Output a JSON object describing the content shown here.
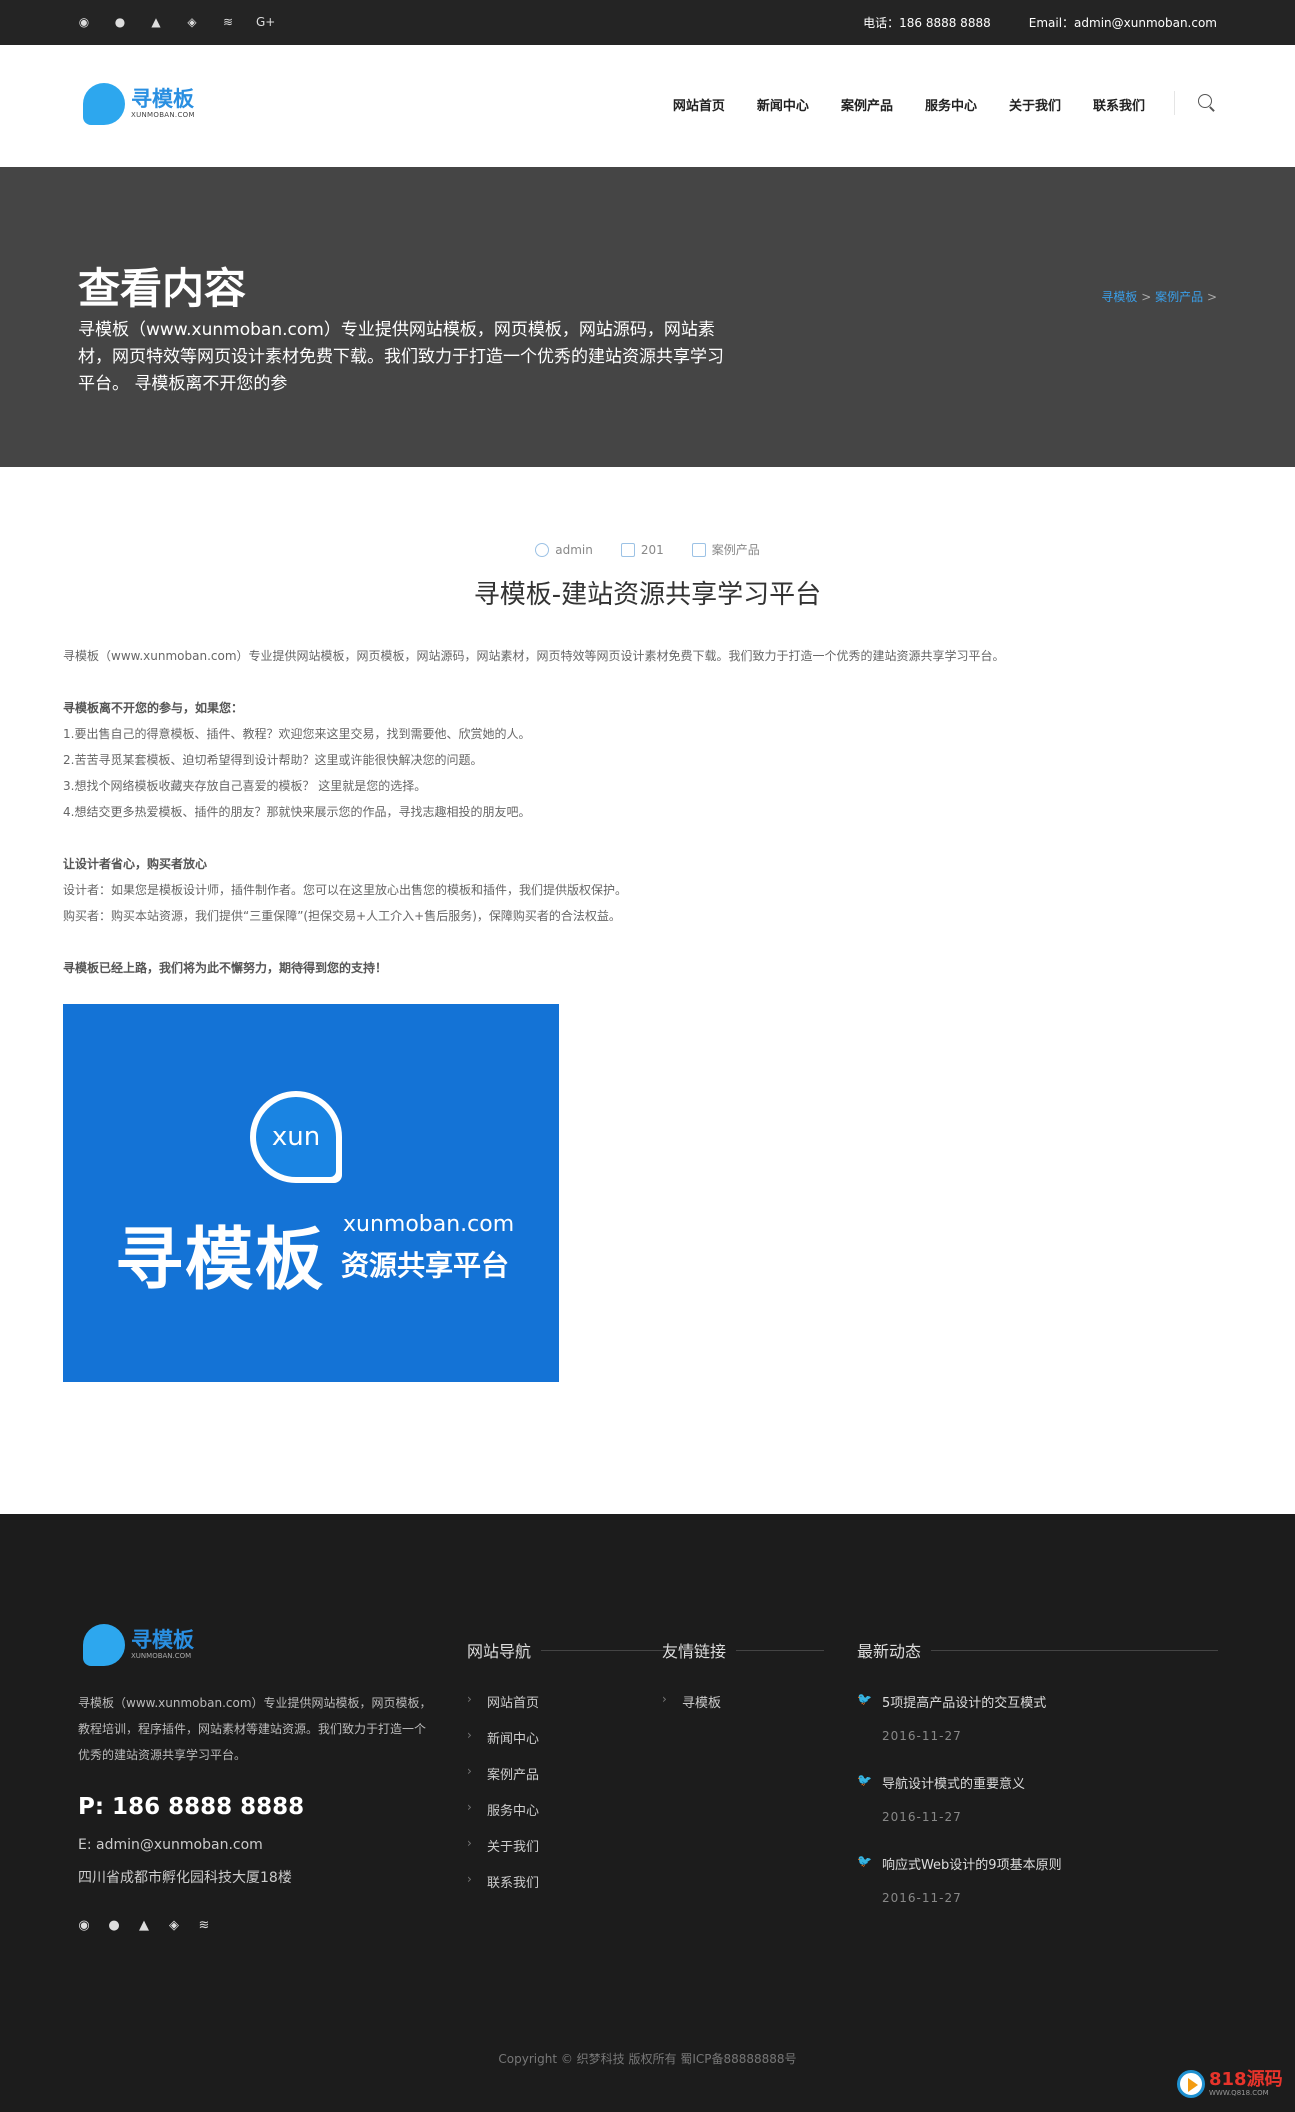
{
  "topbar": {
    "social_icons": [
      "weibo-icon",
      "wechat-icon",
      "qq-icon",
      "apple-icon",
      "rss-icon",
      "google-plus-icon"
    ],
    "social_glyphs": [
      "◉",
      "●",
      "▲",
      "◈",
      "≋",
      "G+"
    ],
    "phone": "电话：186 8888 8888",
    "email": "Email：admin@xunmoban.com"
  },
  "logo": {
    "cn": "寻模板",
    "en": "XUNMOBAN.COM"
  },
  "nav": [
    "网站首页",
    "新闻中心",
    "案例产品",
    "服务中心",
    "关于我们",
    "联系我们"
  ],
  "banner": {
    "title": "查看内容",
    "desc": "寻模板（www.xunmoban.com）专业提供网站模板，网页模板，网站源码，网站素材，网页特效等网页设计素材免费下载。我们致力于打造一个优秀的建站资源共享学习平台。 寻模板离不开您的参",
    "breadcrumb": [
      "寻模板",
      "案例产品"
    ]
  },
  "article": {
    "author": "admin",
    "views": "201",
    "category": "案例产品",
    "title": "寻模板-建站资源共享学习平台",
    "lines": [
      {
        "text": "寻模板（www.xunmoban.com）专业提供网站模板，网页模板，网站源码，网站素材，网页特效等网页设计素材免费下载。我们致力于打造一个优秀的建站资源共享学习平台。",
        "bold": false
      },
      {
        "text": "",
        "bold": false
      },
      {
        "text": "寻模板离不开您的参与，如果您：",
        "bold": true
      },
      {
        "text": "1.要出售自己的得意模板、插件、教程？欢迎您来这里交易，找到需要他、欣赏她的人。",
        "bold": false
      },
      {
        "text": "2.苦苦寻觅某套模板、迫切希望得到设计帮助？这里或许能很快解决您的问题。",
        "bold": false
      },
      {
        "text": "3.想找个网络模板收藏夹存放自己喜爱的模板？ 这里就是您的选择。",
        "bold": false
      },
      {
        "text": "4.想结交更多热爱模板、插件的朋友？那就快来展示您的作品，寻找志趣相投的朋友吧。",
        "bold": false
      },
      {
        "text": "",
        "bold": false
      },
      {
        "text": "让设计者省心，购买者放心",
        "bold": true
      },
      {
        "text": "设计者：如果您是模板设计师，插件制作者。您可以在这里放心出售您的模板和插件，我们提供版权保护。",
        "bold": false
      },
      {
        "text": "购买者：购买本站资源，我们提供“三重保障”(担保交易+人工介入+售后服务)，保障购买者的合法权益。",
        "bold": false
      },
      {
        "text": "",
        "bold": false
      },
      {
        "text": "寻模板已经上路，我们将为此不懈努力，期待得到您的支持！",
        "bold": true
      }
    ],
    "image": {
      "badge": "xun",
      "big": "寻模板",
      "url": "xunmoban.com",
      "slogan": "资源共享平台"
    }
  },
  "footer": {
    "logo": {
      "cn": "寻模板",
      "en": "XUNMOBAN.COM"
    },
    "desc": "寻模板（www.xunmoban.com）专业提供网站模板，网页模板，教程培训，程序插件，网站素材等建站资源。我们致力于打造一个优秀的建站资源共享学习平台。",
    "phone": "P: 186 8888 8888",
    "email": "E: admin@xunmoban.com",
    "address": "四川省成都市孵化园科技大厦18楼",
    "social_icons": [
      "weibo-icon",
      "wechat-icon",
      "qq-icon",
      "apple-icon",
      "rss-icon"
    ],
    "social_glyphs": [
      "◉",
      "●",
      "▲",
      "◈",
      "≋"
    ],
    "nav_title": "网站导航",
    "nav_items": [
      "网站首页",
      "新闻中心",
      "案例产品",
      "服务中心",
      "关于我们",
      "联系我们"
    ],
    "links_title": "友情链接",
    "links_items": [
      "寻模板"
    ],
    "news_title": "最新动态",
    "news": [
      {
        "title": "5项提高产品设计的交互模式",
        "date": "2016-11-27"
      },
      {
        "title": "导航设计模式的重要意义",
        "date": "2016-11-27"
      },
      {
        "title": "响应式Web设计的9项基本原则",
        "date": "2016-11-27"
      }
    ],
    "copyright": "Copyright © 织梦科技 版权所有 蜀ICP备88888888号"
  },
  "watermark": {
    "brand": "818源码",
    "url": "WWW.Q818.COM"
  }
}
